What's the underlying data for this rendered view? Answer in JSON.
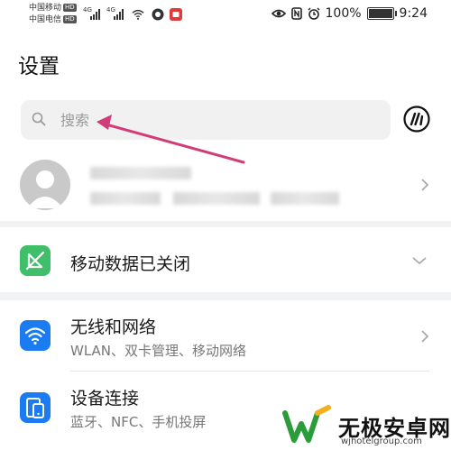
{
  "status_bar": {
    "carrier1": "中国移动",
    "carrier2": "中国电信",
    "hd": "HD",
    "net_type": "4G",
    "battery": "100%",
    "battery_level": 1.0,
    "time": "9:24"
  },
  "header": {
    "title": "设置"
  },
  "search": {
    "placeholder": "搜索"
  },
  "rows": {
    "mobile_data": {
      "title": "移动数据已关闭"
    },
    "wireless": {
      "title": "无线和网络",
      "subtitle": "WLAN、双卡管理、移动网络"
    },
    "device": {
      "title": "设备连接",
      "subtitle": "蓝牙、NFC、手机投屏"
    }
  },
  "colors": {
    "mobile_data_icon": "#3fbf6a",
    "wifi_icon": "#1a7cf0",
    "device_icon": "#1a7cf0",
    "annotation_arrow": "#d13d78"
  },
  "watermark": {
    "title": "无极安卓网",
    "url": "wjhotelgroup.com"
  }
}
